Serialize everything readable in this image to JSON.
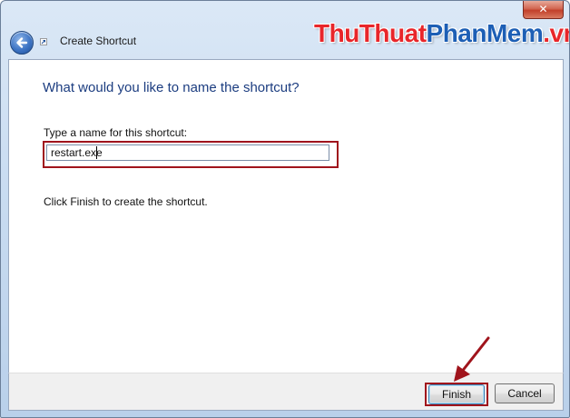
{
  "window": {
    "title": "Create Shortcut",
    "close_glyph": "✕"
  },
  "watermark": {
    "part1": "ThuThuat",
    "part2": "PhanMem",
    "part3": ".vn"
  },
  "content": {
    "heading": "What would you like to name the shortcut?",
    "field_label": "Type a name for this shortcut:",
    "name_value": "restart.exe",
    "instruction": "Click Finish to create the shortcut."
  },
  "footer": {
    "finish_label": "Finish",
    "cancel_label": "Cancel"
  },
  "colors": {
    "highlight": "#a0141c",
    "heading": "#1c3d80",
    "watermark_red": "#e8262a",
    "watermark_blue": "#1d5fb5"
  },
  "icons": [
    "back-arrow-icon",
    "shortcut-arrow-icon",
    "close-icon",
    "annotation-arrow-icon"
  ]
}
